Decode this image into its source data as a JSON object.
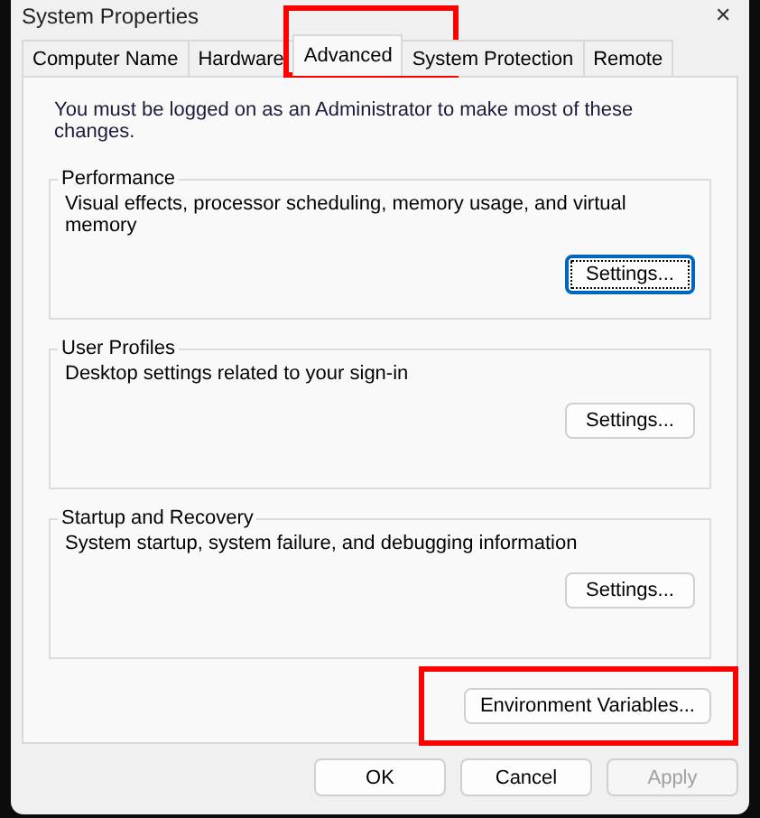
{
  "window": {
    "title": "System Properties",
    "close": "✕"
  },
  "tabs": [
    {
      "label": "Computer Name",
      "selected": false,
      "highlighted": false
    },
    {
      "label": "Hardware",
      "selected": false,
      "highlighted": false
    },
    {
      "label": "Advanced",
      "selected": true,
      "highlighted": true
    },
    {
      "label": "System Protection",
      "selected": false,
      "highlighted": false
    },
    {
      "label": "Remote",
      "selected": false,
      "highlighted": false
    }
  ],
  "notice": "You must be logged on as an Administrator to make most of these changes.",
  "groups": [
    {
      "title": "Performance",
      "description": "Visual effects, processor scheduling, memory usage, and virtual memory",
      "button": {
        "label": "Settings...",
        "focused": true
      }
    },
    {
      "title": "User Profiles",
      "description": "Desktop settings related to your sign-in",
      "button": {
        "label": "Settings...",
        "focused": false
      }
    },
    {
      "title": "Startup and Recovery",
      "description": "System startup, system failure, and debugging information",
      "button": {
        "label": "Settings...",
        "focused": false
      }
    }
  ],
  "environment_button": {
    "label": "Environment Variables...",
    "highlighted": true
  },
  "buttons": [
    {
      "label": "OK",
      "disabled": false
    },
    {
      "label": "Cancel",
      "disabled": false
    },
    {
      "label": "Apply",
      "disabled": true
    }
  ]
}
